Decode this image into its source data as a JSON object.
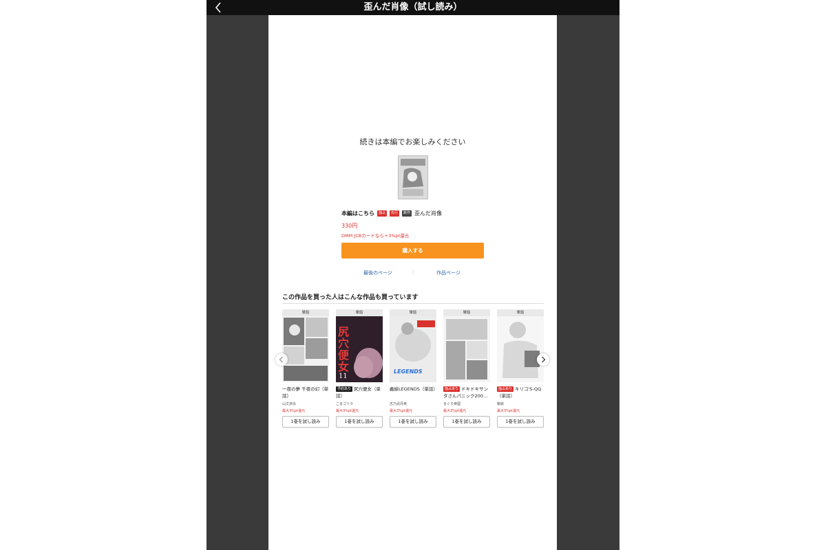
{
  "header": {
    "title": "歪んだ肖像（試し読み）",
    "back_icon": "chevron-left-icon"
  },
  "end_page": {
    "continue_text": "続きは本編でお楽しみください",
    "main_label": "本編はこちら",
    "tags": [
      "独占",
      "先行",
      "新作"
    ],
    "work_title": "歪んだ肖像",
    "price": "330円",
    "jcb_text": "DMM JCBカードなら＋3%pt還元",
    "buy_label": "購入する",
    "link_last_page": "最後のページ",
    "separator": "|",
    "link_work_page": "作品ページ",
    "colors": {
      "accent": "#f7931e",
      "price": "#d9322e",
      "link": "#2a66a8"
    }
  },
  "recommend": {
    "heading": "この作品を買った人はこんな作品も買っています",
    "items": [
      {
        "type": "単話",
        "badge": "",
        "title": "一夜の夢 千夜の幻（単話）",
        "author": "山文京伝",
        "point": "最大3%pt還元",
        "button": "1巻を試し読み"
      },
      {
        "type": "単話",
        "badge": "予約あり",
        "title": "尻穴便女（単話）",
        "author": "ごまゴリラ",
        "point": "最大3%pt還元",
        "button": "1巻を試し読み",
        "cover_text": "尻穴便女",
        "cover_vol": "11"
      },
      {
        "type": "単話",
        "badge": "",
        "title": "義妹LEGENDS（単話）",
        "author": "志乃武丹英",
        "point": "最大3%pt還元",
        "button": "1巻を試し読み",
        "cover_text": "LEGENDS"
      },
      {
        "type": "単話",
        "badge": "独占あり",
        "title": "ドキドキサンタさんパニック200…",
        "author": "まぐろ帝國",
        "point": "最大3%pt還元",
        "button": "1巻を試し読み"
      },
      {
        "type": "単話",
        "badge": "独占あり",
        "title": "キリコ'S-QQ（単話）",
        "author": "鎖鉄",
        "point": "最大3%pt還元",
        "button": "1巻を試し読み"
      }
    ]
  }
}
